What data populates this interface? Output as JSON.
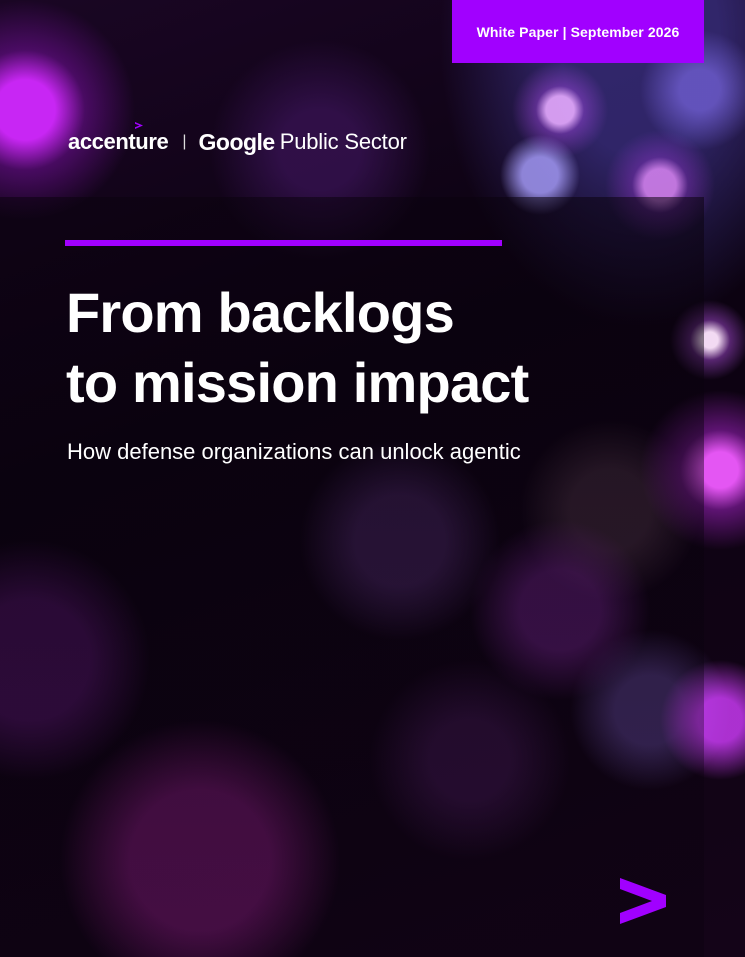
{
  "badge": {
    "text": "White Paper | September 2026"
  },
  "logos": {
    "accenture": "accenture",
    "separator": "|",
    "google": "Google",
    "public_sector": "Public Sector"
  },
  "title": {
    "line1": "From backlogs",
    "line2": "to mission impact"
  },
  "subtitle": "How defense organizations can unlock agentic",
  "colors": {
    "accent": "#a100ff",
    "text": "#ffffff",
    "background": "#0b0210"
  },
  "icons": {
    "brand_mark": "accenture-greater-than-icon"
  }
}
